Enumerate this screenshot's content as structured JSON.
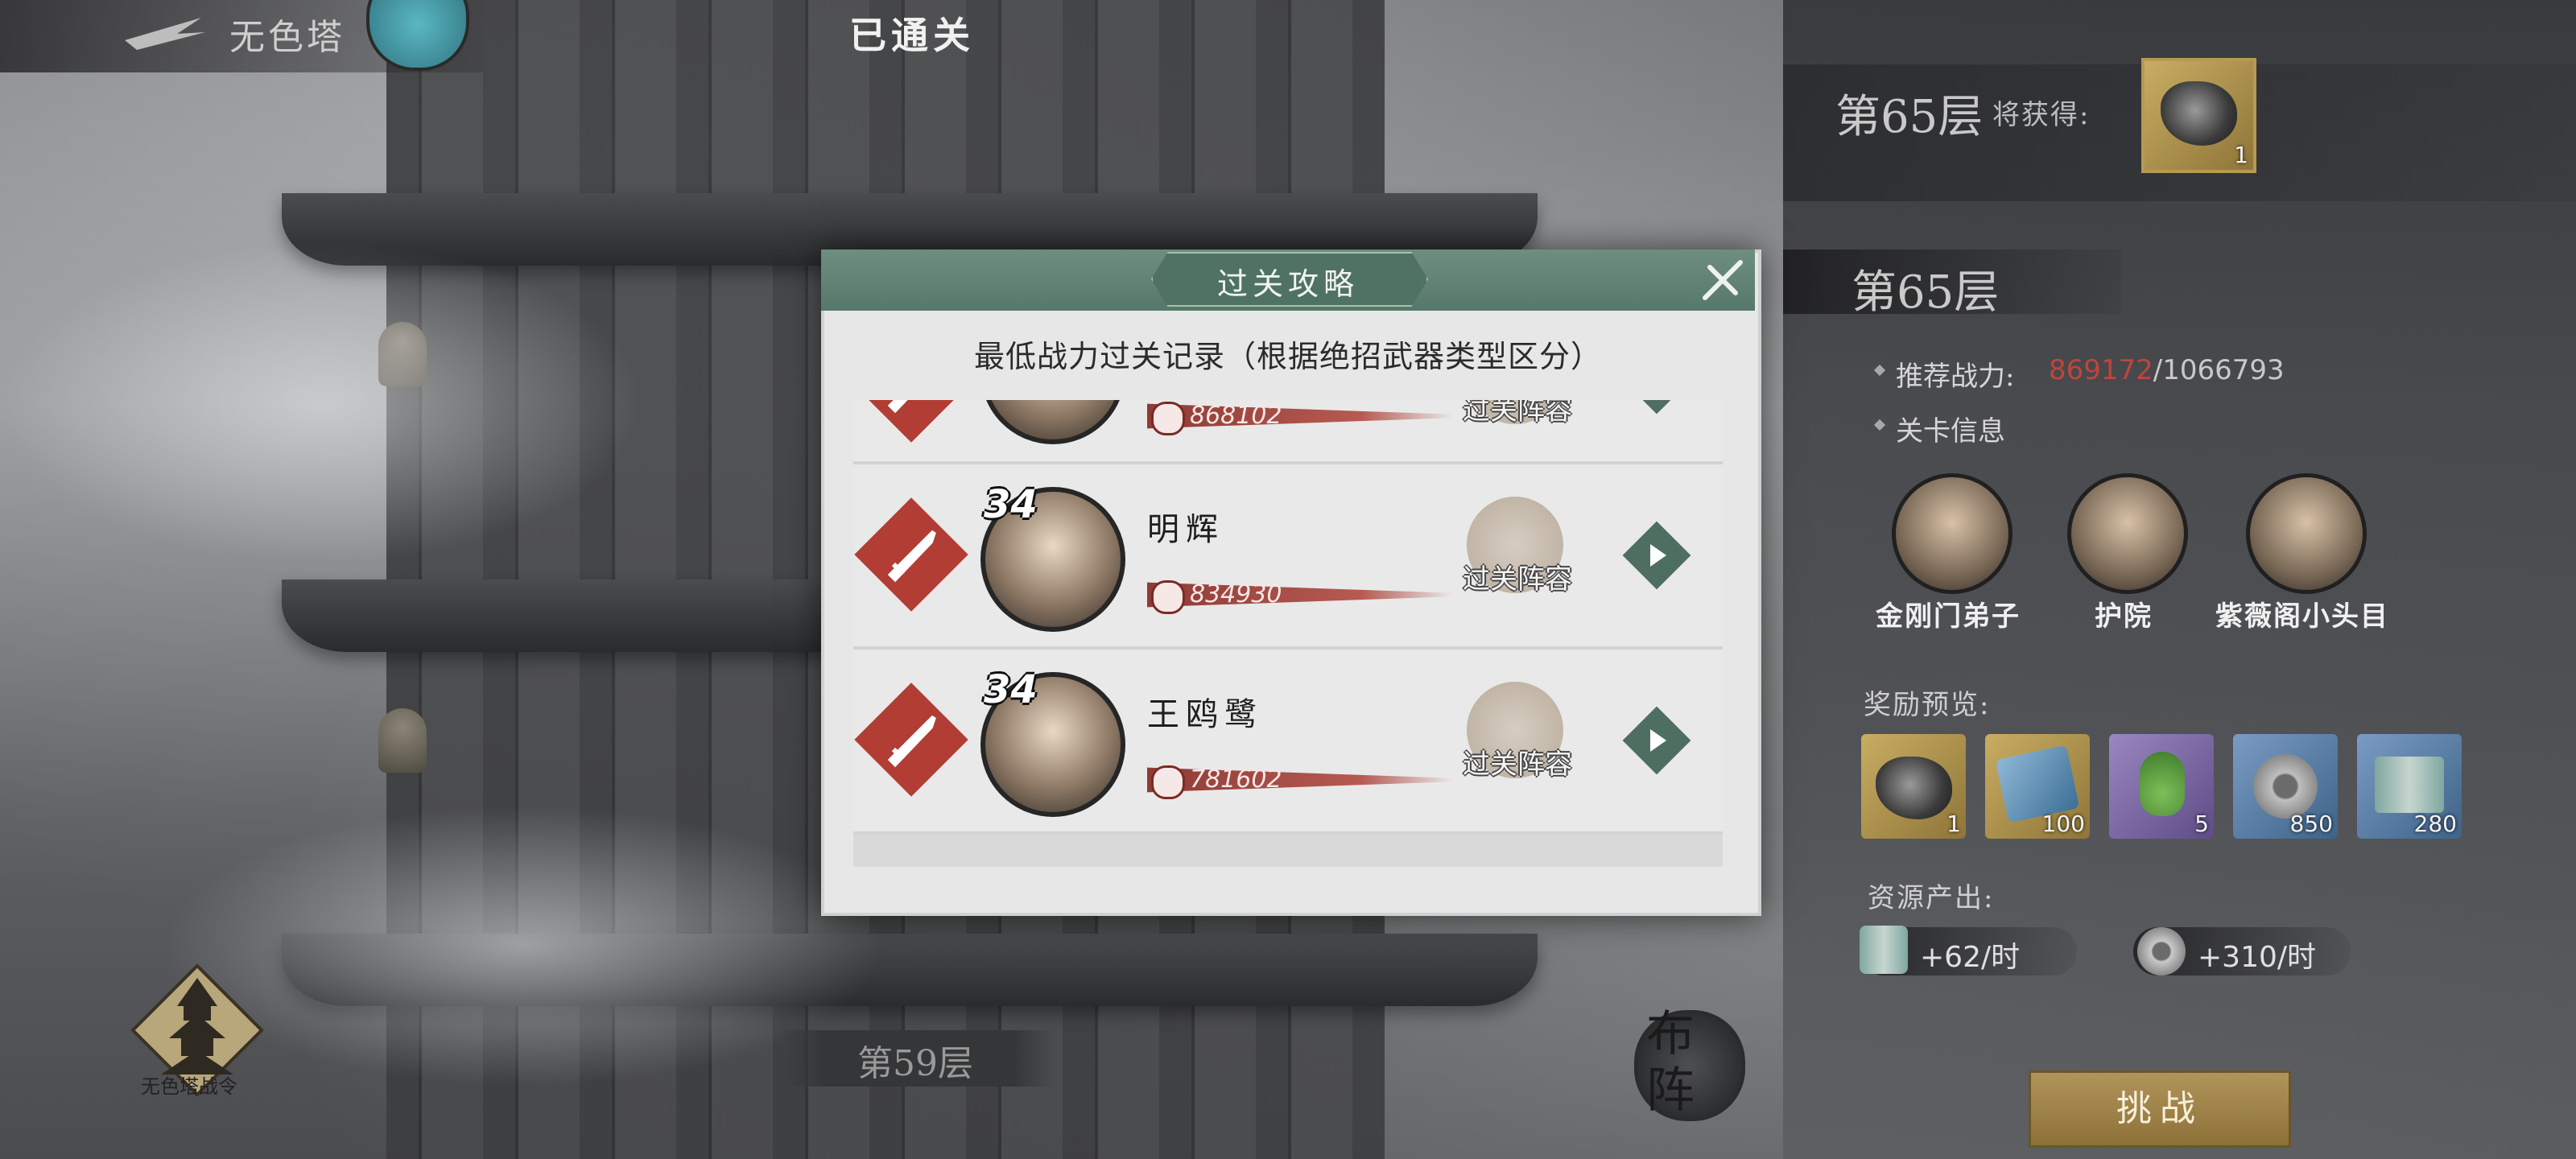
{
  "header": {
    "tower_name": "无色塔",
    "clear_title": "已通关"
  },
  "reward_summary": {
    "floor": "第65层",
    "will_get": "将获得:",
    "item_qty": "1"
  },
  "stage": {
    "floor": "第65层",
    "recommended_label": "推荐战力:",
    "recommended_current": "869172",
    "recommended_separator": "/",
    "recommended_target": "1066793",
    "info_label": "关卡信息",
    "enemies": [
      {
        "name": "金刚门弟子"
      },
      {
        "name": "护院"
      },
      {
        "name": "紫薇阁小头目"
      }
    ],
    "reward_preview_label": "奖励预览:",
    "rewards": [
      {
        "icon": "ore-icon",
        "qty": "1",
        "bg": "#b9a15c"
      },
      {
        "icon": "scroll-map-icon",
        "qty": "100",
        "bg": "#b9a15c"
      },
      {
        "icon": "potion-icon",
        "qty": "5",
        "bg": "#7d6aa3"
      },
      {
        "icon": "coin-icon",
        "qty": "850",
        "bg": "#5d7fa8"
      },
      {
        "icon": "book-icon",
        "qty": "280",
        "bg": "#5d7fa8"
      }
    ],
    "resource_label": "资源产出:",
    "resources": [
      {
        "icon": "book-icon",
        "text": "+62/时"
      },
      {
        "icon": "coin-icon",
        "text": "+310/时"
      }
    ],
    "challenge_label": "挑战"
  },
  "bottom": {
    "tower_menu_label": "无色塔战令",
    "current_floor": "第59层",
    "formation_label": "布阵"
  },
  "modal": {
    "title": "过关攻略",
    "subtitle": "最低战力过关记录（根据绝招武器类型区分）",
    "records": [
      {
        "level": "",
        "name": "",
        "power": "868102",
        "lineup_label": "过关阵容",
        "weapon": "sword"
      },
      {
        "level": "34",
        "name": "明辉",
        "power": "834930",
        "lineup_label": "过关阵容",
        "weapon": "sword"
      },
      {
        "level": "34",
        "name": "王鸥鹭",
        "power": "781602",
        "lineup_label": "过关阵容",
        "weapon": "sword"
      }
    ]
  },
  "colors": {
    "modal_header": "#56786a",
    "power_red": "#c0443d",
    "weapon_badge": "#b13d35",
    "challenge_gold": "#b1945a"
  }
}
